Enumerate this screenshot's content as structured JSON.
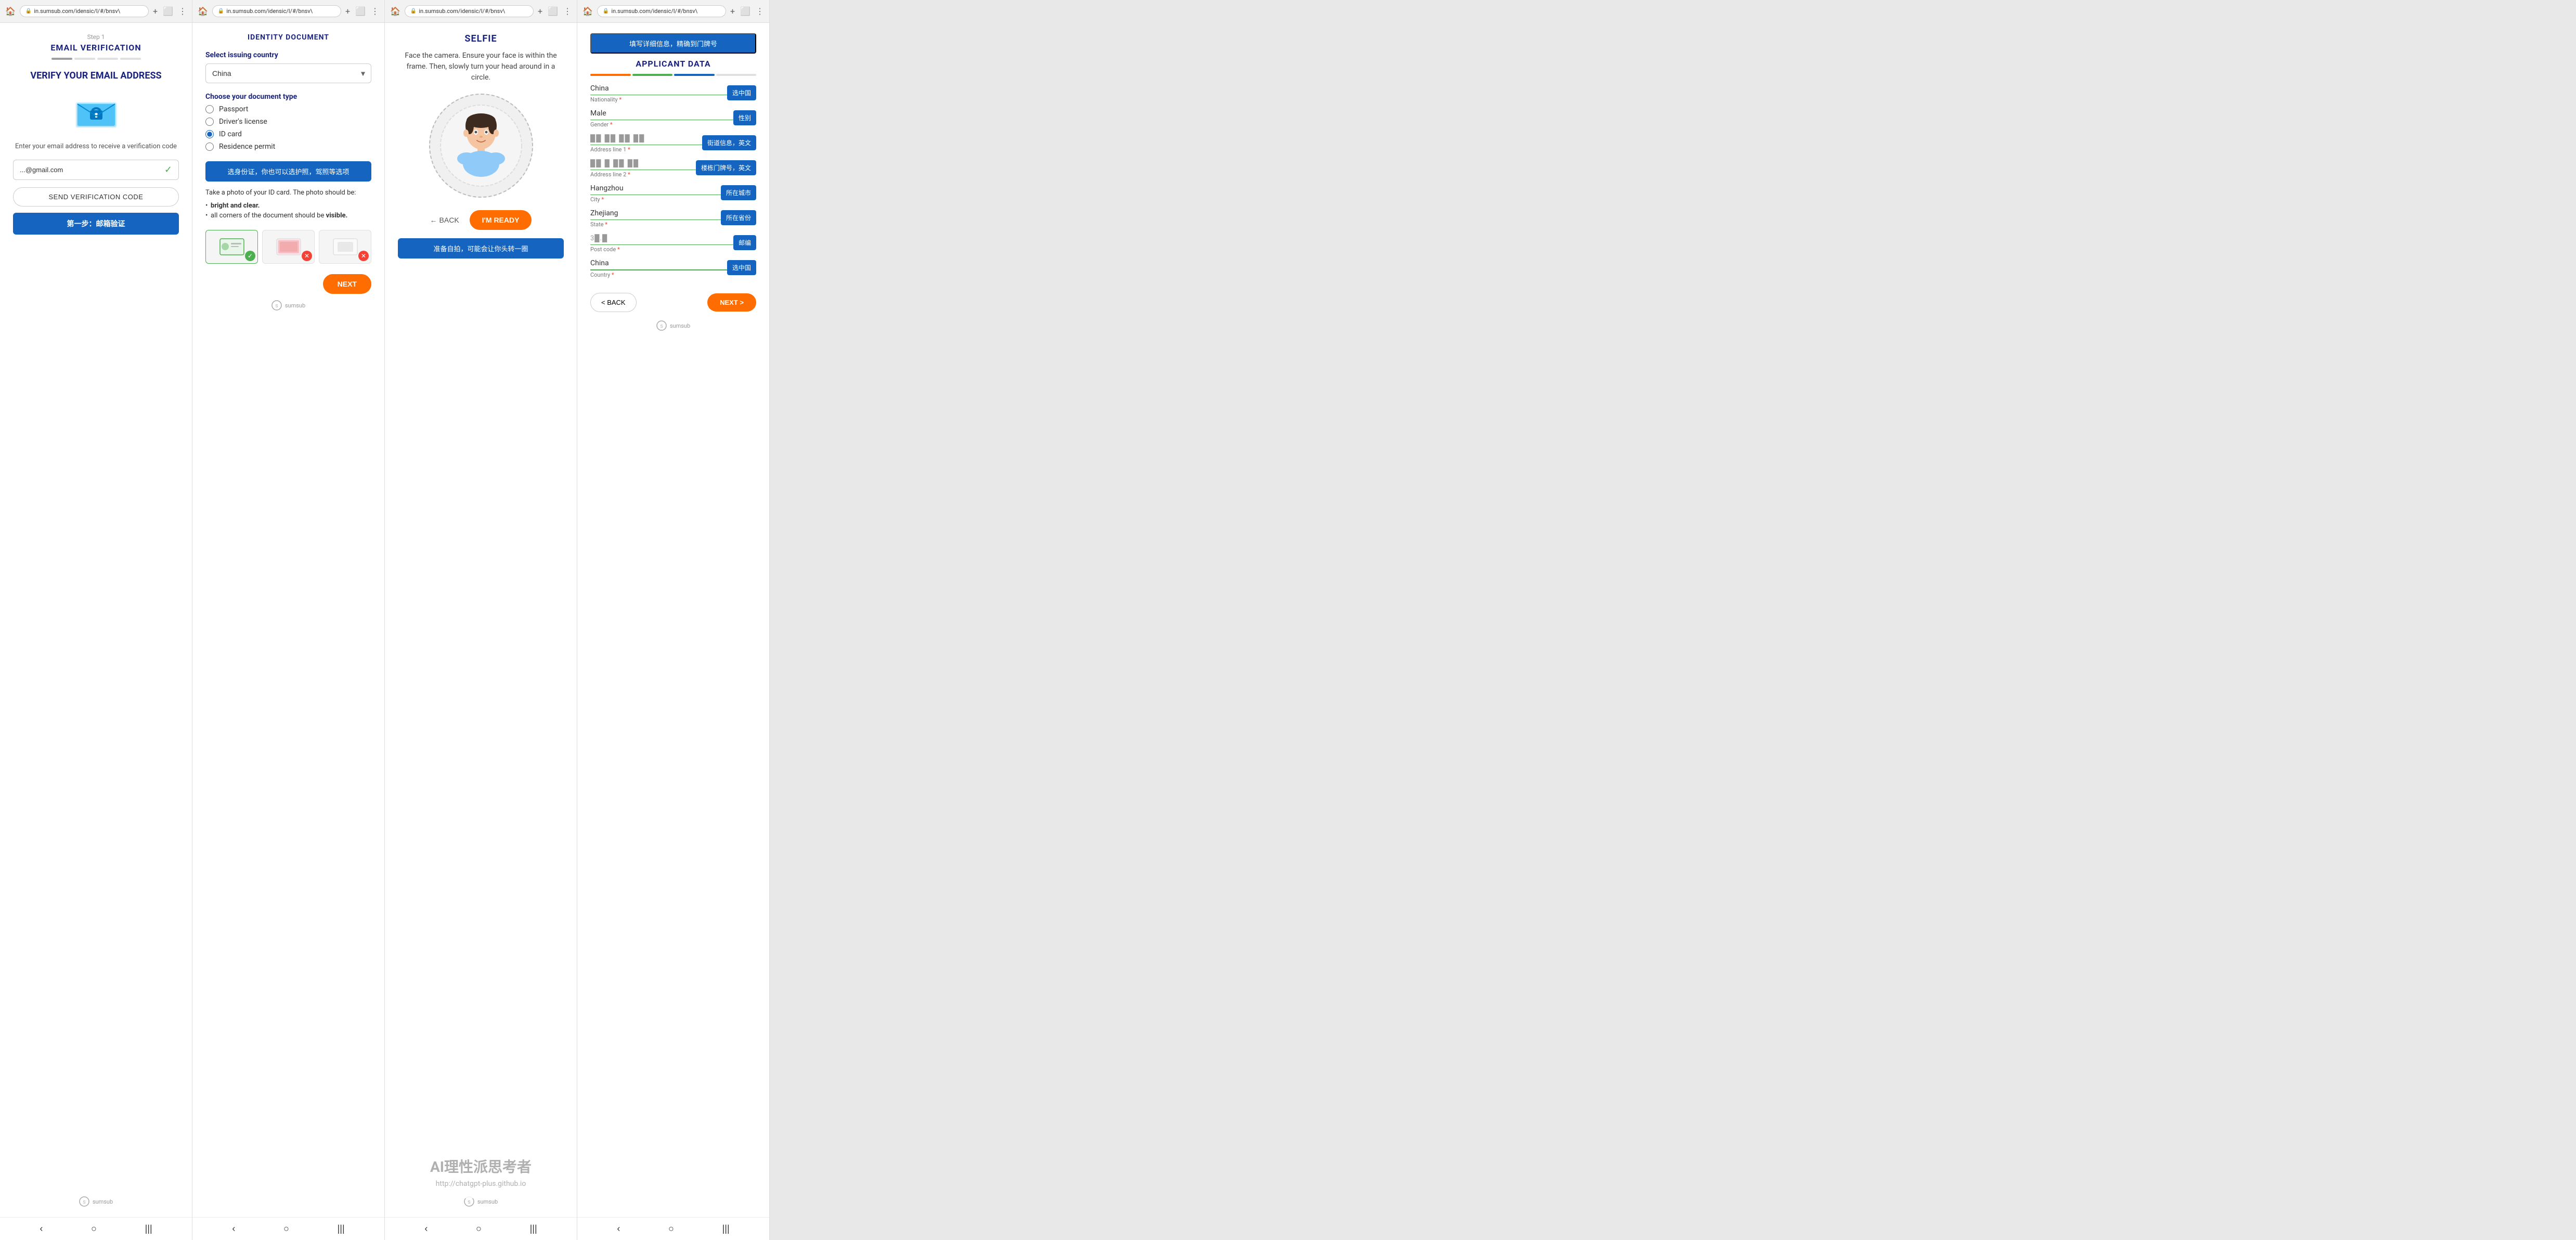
{
  "panel1": {
    "browser": {
      "url": "in.sumsub.com/idensic/l/#/bnsv\\"
    },
    "stepLabel": "Step 1",
    "title": "EMAIL VERIFICATION",
    "progressSegments": [
      "active",
      "inactive",
      "inactive",
      "inactive"
    ],
    "verifyTitle": "VERIFY YOUR EMAIL ADDRESS",
    "description": "Enter your email address to receive a verification code",
    "emailPlaceholder": "...@gmail.com",
    "emailValue": "...@gmail.com",
    "sendBtnLabel": "SEND VERIFICATION CODE",
    "chineseBtnLabel": "第一步：邮箱验证",
    "sumsub": "sumsub"
  },
  "panel2": {
    "browser": {
      "url": "in.sumsub.com/idensic/l/#/bnsv\\"
    },
    "title": "IDENTITY DOCUMENT",
    "selectCountryLabel": "Select issuing country",
    "countryValue": "China",
    "docTypeLabel": "Choose your document type",
    "docTypes": [
      {
        "label": "Passport",
        "checked": false
      },
      {
        "label": "Driver's license",
        "checked": false
      },
      {
        "label": "ID card",
        "checked": true
      },
      {
        "label": "Residence permit",
        "checked": false
      }
    ],
    "chineseBtnLabel": "选身份证，你也可以选护照，驾照等选项",
    "photoDesc": "Take a photo of your ID card. The photo should be:",
    "bullets": [
      "bright and clear.",
      "all corners of the document should be visible."
    ],
    "nextBtnLabel": "NEXT",
    "sumsub": "sumsub"
  },
  "panel3": {
    "browser": {
      "url": "in.sumsub.com/idensic/l/#/bnsv\\"
    },
    "title": "SELFIE",
    "description": "Face the camera. Ensure your face is within the frame. Then, slowly turn your head around in a circle.",
    "backBtnLabel": "BACK",
    "readyBtnLabel": "I'M READY",
    "chineseBtnLabel": "准备自拍，可能会让你头转一圈",
    "watermark": {
      "big": "AI理性派思考者",
      "small": "http://chatgpt-plus.github.io"
    },
    "sumsub": "sumsub"
  },
  "panel4": {
    "browser": {
      "url": "in.sumsub.com/idensic/l/#/bnsv\\"
    },
    "headerBtn": "填写详细信息，精确到门牌号",
    "title": "APPLICANT DATA",
    "fields": [
      {
        "value": "China",
        "label": "Nationality",
        "required": true,
        "btnLabel": "选中国",
        "type": "select"
      },
      {
        "value": "Male",
        "label": "Gender",
        "required": true,
        "btnLabel": "性别",
        "type": "select"
      },
      {
        "value": "█..█ █ █..█ █..█",
        "label": "Address line 1",
        "required": true,
        "btnLabel": "街道信息，英文",
        "type": "text"
      },
      {
        "value": "█..█.█ █..█ █..█",
        "label": "Address line 2",
        "required": true,
        "btnLabel": "楼栋门牌号，英文",
        "type": "text"
      },
      {
        "value": "Hangzhou",
        "label": "City",
        "required": true,
        "btnLabel": "所在城市",
        "type": "text"
      },
      {
        "value": "Zhejiang",
        "label": "State",
        "required": true,
        "btnLabel": "所在省份",
        "type": "text"
      },
      {
        "value": "3█.█",
        "label": "Post code",
        "required": true,
        "btnLabel": "邮编",
        "type": "text"
      },
      {
        "value": "China",
        "label": "Country",
        "required": true,
        "btnLabel": "选中国",
        "type": "select"
      }
    ],
    "backBtnLabel": "< BACK",
    "nextBtnLabel": "NEXT >",
    "sumsub": "sumsub"
  },
  "icons": {
    "back": "‹",
    "home": "○",
    "menu": "|||",
    "plus": "+",
    "tabs": "⬜",
    "more": "⋮",
    "check": "✓",
    "chevronDown": "▾",
    "arrowLeft": "←"
  }
}
